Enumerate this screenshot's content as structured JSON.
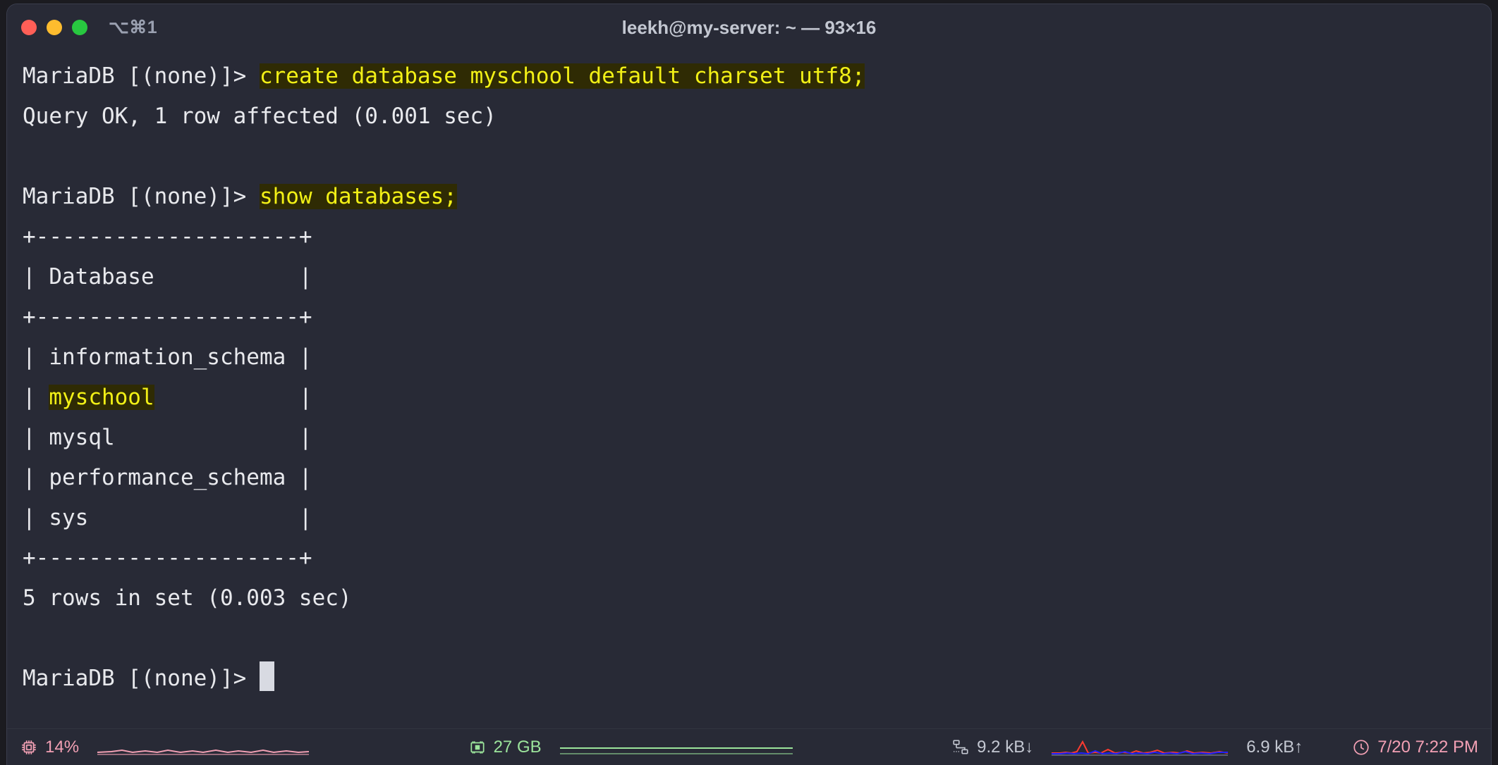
{
  "window": {
    "title": "leekh@my-server: ~ — 93×16",
    "shortcut": "⌥⌘1",
    "traffic_lights": [
      "close",
      "minimize",
      "zoom"
    ],
    "colors": {
      "background": "#282a36",
      "foreground": "#e8e9ed",
      "highlight_bg": "#2f2b04",
      "highlight_fg": "#f2f016",
      "cpu": "#f2a0b4",
      "mem": "#9ce59c",
      "net_down": "#ff3b30",
      "net_up": "#2020ff",
      "clock": "#f2a0b4"
    }
  },
  "terminal": {
    "lines": [
      {
        "prompt": "MariaDB [(none)]> ",
        "highlight": "create database myschool default charset utf8;",
        "tail": ""
      },
      {
        "text": "Query OK, 1 row affected (0.001 sec)"
      },
      {
        "text": ""
      },
      {
        "prompt": "MariaDB [(none)]> ",
        "highlight": "show databases;",
        "tail": ""
      },
      {
        "text": "+--------------------+"
      },
      {
        "text": "| Database           |"
      },
      {
        "text": "+--------------------+"
      },
      {
        "text": "| information_schema |"
      },
      {
        "pre": "| ",
        "highlight": "myschool",
        "post": "           |"
      },
      {
        "text": "| mysql              |"
      },
      {
        "text": "| performance_schema |"
      },
      {
        "text": "| sys                |"
      },
      {
        "text": "+--------------------+"
      },
      {
        "text": "5 rows in set (0.003 sec)"
      },
      {
        "text": ""
      },
      {
        "prompt": "MariaDB [(none)]> ",
        "cursor": true
      }
    ]
  },
  "statusbar": {
    "cpu": {
      "icon": "cpu-chip-icon",
      "value": "14%"
    },
    "memory": {
      "icon": "memory-stick-icon",
      "value": "27 GB"
    },
    "network": {
      "icon": "network-icon",
      "download": "9.2 kB↓",
      "upload": "6.9 kB↑"
    },
    "clock": {
      "icon": "clock-icon",
      "value": "7/20 7:22 PM"
    }
  }
}
